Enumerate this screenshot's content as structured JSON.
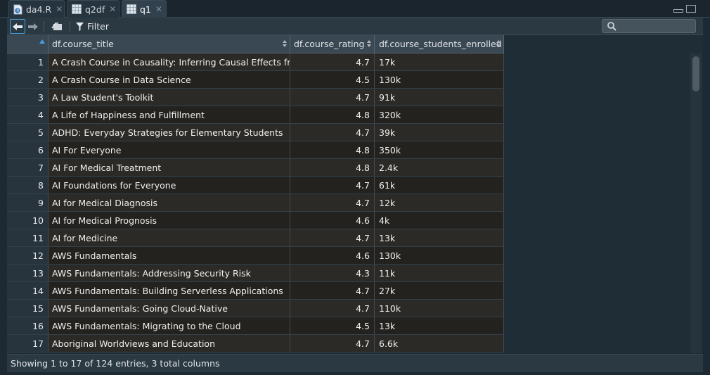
{
  "tabs": [
    {
      "label": "da4.R",
      "icon": "r-file-icon",
      "active": false
    },
    {
      "label": "q2df",
      "icon": "table-icon",
      "active": false
    },
    {
      "label": "q1",
      "icon": "table-icon",
      "active": true
    }
  ],
  "toolbar": {
    "filter_label": "Filter",
    "search_placeholder": ""
  },
  "table": {
    "columns": [
      "",
      "df.course_title",
      "df.course_rating",
      "df.course_students_enrolled"
    ],
    "rows": [
      [
        "1",
        "A Crash Course in Causality:  Inferring Causal Effects from O...",
        "4.7",
        "17k"
      ],
      [
        "2",
        "A Crash Course in Data Science",
        "4.5",
        "130k"
      ],
      [
        "3",
        "A Law Student's Toolkit",
        "4.7",
        "91k"
      ],
      [
        "4",
        "A Life of Happiness and Fulfillment",
        "4.8",
        "320k"
      ],
      [
        "5",
        "ADHD: Everyday Strategies for Elementary Students",
        "4.7",
        "39k"
      ],
      [
        "6",
        "AI For Everyone",
        "4.8",
        "350k"
      ],
      [
        "7",
        "AI For Medical Treatment",
        "4.8",
        "2.4k"
      ],
      [
        "8",
        "AI Foundations for Everyone",
        "4.7",
        "61k"
      ],
      [
        "9",
        "AI for Medical Diagnosis",
        "4.7",
        "12k"
      ],
      [
        "10",
        "AI for Medical Prognosis",
        "4.6",
        "4k"
      ],
      [
        "11",
        "AI for Medicine",
        "4.7",
        "13k"
      ],
      [
        "12",
        "AWS Fundamentals",
        "4.6",
        "130k"
      ],
      [
        "13",
        "AWS Fundamentals: Addressing Security Risk",
        "4.3",
        "11k"
      ],
      [
        "14",
        "AWS Fundamentals: Building Serverless Applications",
        "4.7",
        "27k"
      ],
      [
        "15",
        "AWS Fundamentals: Going Cloud-Native",
        "4.7",
        "110k"
      ],
      [
        "16",
        "AWS Fundamentals: Migrating to the Cloud",
        "4.5",
        "13k"
      ],
      [
        "17",
        "Aboriginal Worldviews and Education",
        "4.7",
        "6.6k"
      ]
    ]
  },
  "footer": {
    "status": "Showing 1 to 17 of 124 entries, 3 total columns"
  },
  "colors": {
    "background": "#1e2a33",
    "header": "#3a4853",
    "row_odd": "#2b2a26",
    "row_even": "#23221f",
    "accent": "#4a9fe0"
  }
}
